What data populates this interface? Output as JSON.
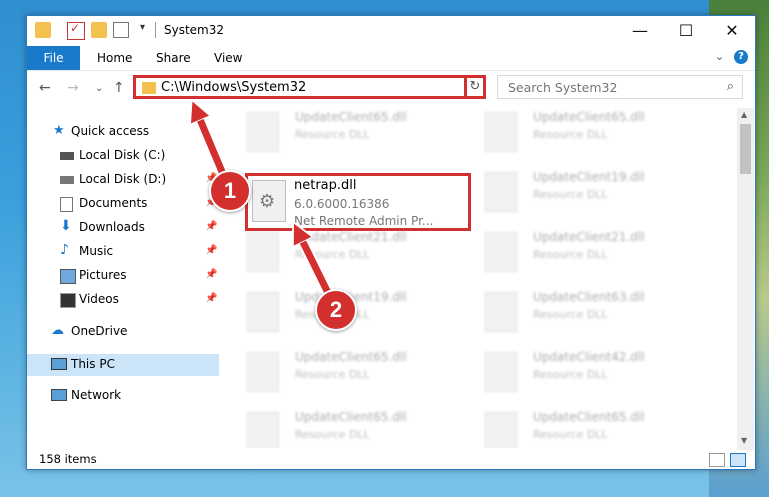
{
  "window": {
    "title": "System32",
    "controls": {
      "minimize": "—",
      "maximize": "☐",
      "close": "✕"
    }
  },
  "ribbon": {
    "tabs": [
      {
        "label": "File"
      },
      {
        "label": "Home"
      },
      {
        "label": "Share"
      },
      {
        "label": "View"
      }
    ]
  },
  "nav": {
    "address": "C:\\Windows\\System32",
    "search_placeholder": "Search System32"
  },
  "sidebar": {
    "items": [
      {
        "label": "Quick access"
      },
      {
        "label": "Local Disk (C:)"
      },
      {
        "label": "Local Disk (D:)"
      },
      {
        "label": "Documents"
      },
      {
        "label": "Downloads"
      },
      {
        "label": "Music"
      },
      {
        "label": "Pictures"
      },
      {
        "label": "Videos"
      },
      {
        "label": "OneDrive"
      },
      {
        "label": "This PC"
      },
      {
        "label": "Network"
      }
    ]
  },
  "files": {
    "highlighted": {
      "name": "netrap.dll",
      "version": "6.0.6000.16386",
      "description": "Net Remote Admin Pr..."
    },
    "blurred": [
      {
        "name": "UpdateClient65.dll",
        "type": "Resource DLL"
      },
      {
        "name": "UpdateClient65.dll",
        "type": "Resource DLL"
      },
      {
        "name": "UpdateClient19.dll",
        "type": "Resource DLL"
      },
      {
        "name": "UpdateClient21.dll",
        "type": "Resource DLL"
      },
      {
        "name": "UpdateClient21.dll",
        "type": "Resource DLL"
      },
      {
        "name": "UpdateClient19.dll",
        "type": "Resource DLL"
      },
      {
        "name": "UpdateClient63.dll",
        "type": "Resource DLL"
      },
      {
        "name": "UpdateClient65.dll",
        "type": "Resource DLL"
      },
      {
        "name": "UpdateClient42.dll",
        "type": "Resource DLL"
      },
      {
        "name": "UpdateClient65.dll",
        "type": "Resource DLL"
      },
      {
        "name": "UpdateClient65.dll",
        "type": "Resource DLL"
      }
    ]
  },
  "status": {
    "item_count": "158 items"
  },
  "annotations": {
    "step1": "1",
    "step2": "2",
    "color": "#d32f2f"
  }
}
